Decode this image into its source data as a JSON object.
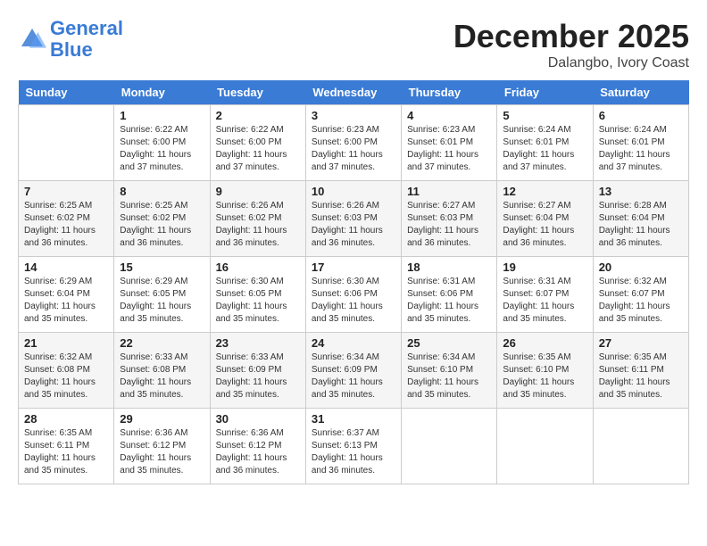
{
  "header": {
    "logo_line1": "General",
    "logo_line2": "Blue",
    "month": "December 2025",
    "location": "Dalangbo, Ivory Coast"
  },
  "weekdays": [
    "Sunday",
    "Monday",
    "Tuesday",
    "Wednesday",
    "Thursday",
    "Friday",
    "Saturday"
  ],
  "weeks": [
    [
      {
        "day": null,
        "info": null
      },
      {
        "day": "1",
        "sunrise": "6:22 AM",
        "sunset": "6:00 PM",
        "daylight": "11 hours and 37 minutes."
      },
      {
        "day": "2",
        "sunrise": "6:22 AM",
        "sunset": "6:00 PM",
        "daylight": "11 hours and 37 minutes."
      },
      {
        "day": "3",
        "sunrise": "6:23 AM",
        "sunset": "6:00 PM",
        "daylight": "11 hours and 37 minutes."
      },
      {
        "day": "4",
        "sunrise": "6:23 AM",
        "sunset": "6:01 PM",
        "daylight": "11 hours and 37 minutes."
      },
      {
        "day": "5",
        "sunrise": "6:24 AM",
        "sunset": "6:01 PM",
        "daylight": "11 hours and 37 minutes."
      },
      {
        "day": "6",
        "sunrise": "6:24 AM",
        "sunset": "6:01 PM",
        "daylight": "11 hours and 37 minutes."
      }
    ],
    [
      {
        "day": "7",
        "sunrise": "6:25 AM",
        "sunset": "6:02 PM",
        "daylight": "11 hours and 36 minutes."
      },
      {
        "day": "8",
        "sunrise": "6:25 AM",
        "sunset": "6:02 PM",
        "daylight": "11 hours and 36 minutes."
      },
      {
        "day": "9",
        "sunrise": "6:26 AM",
        "sunset": "6:02 PM",
        "daylight": "11 hours and 36 minutes."
      },
      {
        "day": "10",
        "sunrise": "6:26 AM",
        "sunset": "6:03 PM",
        "daylight": "11 hours and 36 minutes."
      },
      {
        "day": "11",
        "sunrise": "6:27 AM",
        "sunset": "6:03 PM",
        "daylight": "11 hours and 36 minutes."
      },
      {
        "day": "12",
        "sunrise": "6:27 AM",
        "sunset": "6:04 PM",
        "daylight": "11 hours and 36 minutes."
      },
      {
        "day": "13",
        "sunrise": "6:28 AM",
        "sunset": "6:04 PM",
        "daylight": "11 hours and 36 minutes."
      }
    ],
    [
      {
        "day": "14",
        "sunrise": "6:29 AM",
        "sunset": "6:04 PM",
        "daylight": "11 hours and 35 minutes."
      },
      {
        "day": "15",
        "sunrise": "6:29 AM",
        "sunset": "6:05 PM",
        "daylight": "11 hours and 35 minutes."
      },
      {
        "day": "16",
        "sunrise": "6:30 AM",
        "sunset": "6:05 PM",
        "daylight": "11 hours and 35 minutes."
      },
      {
        "day": "17",
        "sunrise": "6:30 AM",
        "sunset": "6:06 PM",
        "daylight": "11 hours and 35 minutes."
      },
      {
        "day": "18",
        "sunrise": "6:31 AM",
        "sunset": "6:06 PM",
        "daylight": "11 hours and 35 minutes."
      },
      {
        "day": "19",
        "sunrise": "6:31 AM",
        "sunset": "6:07 PM",
        "daylight": "11 hours and 35 minutes."
      },
      {
        "day": "20",
        "sunrise": "6:32 AM",
        "sunset": "6:07 PM",
        "daylight": "11 hours and 35 minutes."
      }
    ],
    [
      {
        "day": "21",
        "sunrise": "6:32 AM",
        "sunset": "6:08 PM",
        "daylight": "11 hours and 35 minutes."
      },
      {
        "day": "22",
        "sunrise": "6:33 AM",
        "sunset": "6:08 PM",
        "daylight": "11 hours and 35 minutes."
      },
      {
        "day": "23",
        "sunrise": "6:33 AM",
        "sunset": "6:09 PM",
        "daylight": "11 hours and 35 minutes."
      },
      {
        "day": "24",
        "sunrise": "6:34 AM",
        "sunset": "6:09 PM",
        "daylight": "11 hours and 35 minutes."
      },
      {
        "day": "25",
        "sunrise": "6:34 AM",
        "sunset": "6:10 PM",
        "daylight": "11 hours and 35 minutes."
      },
      {
        "day": "26",
        "sunrise": "6:35 AM",
        "sunset": "6:10 PM",
        "daylight": "11 hours and 35 minutes."
      },
      {
        "day": "27",
        "sunrise": "6:35 AM",
        "sunset": "6:11 PM",
        "daylight": "11 hours and 35 minutes."
      }
    ],
    [
      {
        "day": "28",
        "sunrise": "6:35 AM",
        "sunset": "6:11 PM",
        "daylight": "11 hours and 35 minutes."
      },
      {
        "day": "29",
        "sunrise": "6:36 AM",
        "sunset": "6:12 PM",
        "daylight": "11 hours and 35 minutes."
      },
      {
        "day": "30",
        "sunrise": "6:36 AM",
        "sunset": "6:12 PM",
        "daylight": "11 hours and 36 minutes."
      },
      {
        "day": "31",
        "sunrise": "6:37 AM",
        "sunset": "6:13 PM",
        "daylight": "11 hours and 36 minutes."
      },
      {
        "day": null,
        "info": null
      },
      {
        "day": null,
        "info": null
      },
      {
        "day": null,
        "info": null
      }
    ]
  ]
}
